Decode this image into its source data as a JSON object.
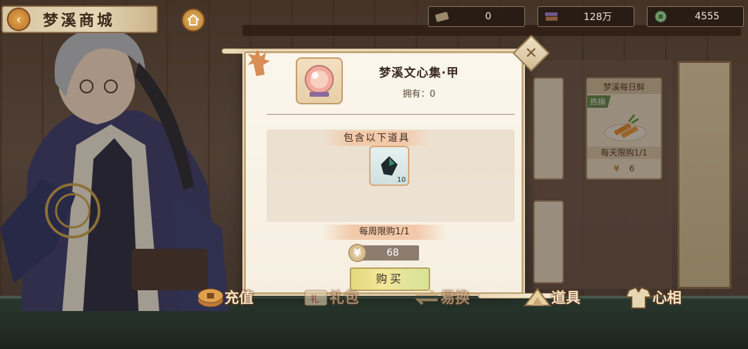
{
  "header": {
    "title": "梦溪商城"
  },
  "currencies": [
    {
      "icon": "ticket-icon",
      "value": "0"
    },
    {
      "icon": "book-stack-icon",
      "value": "128万"
    },
    {
      "icon": "jade-coin-icon",
      "value": "4555"
    }
  ],
  "background_cards": [
    {
      "name": "梦溪每日鲜",
      "badge": "热销",
      "limit": "每天限购1/1",
      "price": "6"
    }
  ],
  "modal": {
    "item_name": "梦溪文心集·甲",
    "owned_label": "拥有：0",
    "contents_title": "包含以下道具",
    "sub_item_qty": "10",
    "limit_text": "每周限购1/1",
    "price_symbol": "¥",
    "price": "68",
    "buy_label": "购买"
  },
  "tabs": [
    {
      "label": "充值",
      "icon": "coins-icon",
      "dim": false
    },
    {
      "label": "礼包",
      "icon": "gift-pack-icon",
      "dim": true
    },
    {
      "label": "易换",
      "icon": "exchange-icon",
      "dim": true
    },
    {
      "label": "道具",
      "icon": "props-icon",
      "dim": false
    },
    {
      "label": "心相",
      "icon": "robe-icon",
      "dim": false
    }
  ],
  "colors": {
    "accent": "#c4a877",
    "counter": "#2f4a3f",
    "buy_button": "#f3e69a"
  }
}
